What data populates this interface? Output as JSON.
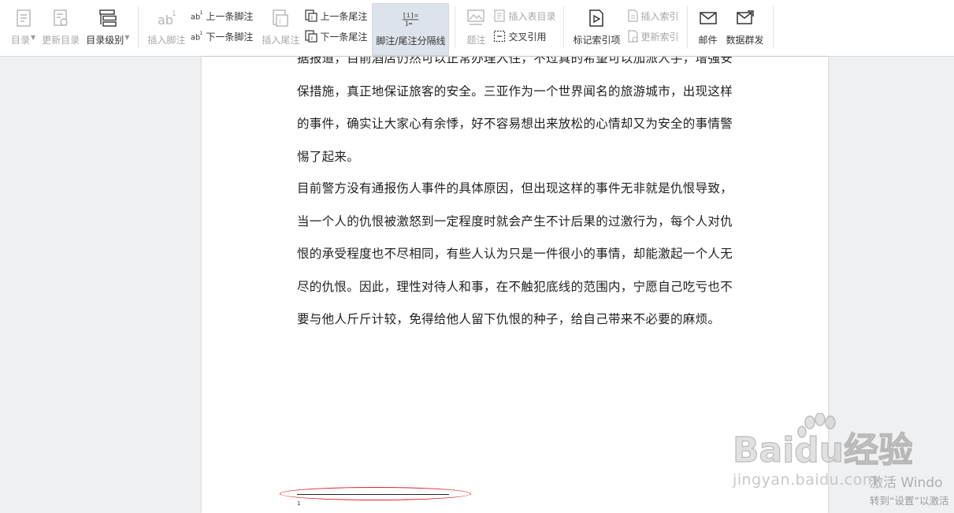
{
  "ribbon": {
    "toc": {
      "label": "目录"
    },
    "update_toc": {
      "label": "更新目录"
    },
    "toc_level": {
      "label": "目录级别"
    },
    "insert_footnote": {
      "label": "插入脚注"
    },
    "prev_footnote": {
      "label": "上一条脚注"
    },
    "next_footnote": {
      "label": "下一条脚注"
    },
    "insert_endnote": {
      "label": "插入尾注"
    },
    "prev_endnote": {
      "label": "上一条尾注"
    },
    "next_endnote": {
      "label": "下一条尾注"
    },
    "note_separator": {
      "label": "脚注/尾注分隔线"
    },
    "caption": {
      "label": "题注"
    },
    "insert_table_of_figures": {
      "label": "插入表目录"
    },
    "cross_reference": {
      "label": "交叉引用"
    },
    "mark_index_entry": {
      "label": "标记索引项"
    },
    "insert_index": {
      "label": "插入索引"
    },
    "update_index": {
      "label": "更新索引"
    },
    "mail": {
      "label": "邮件"
    },
    "mail_merge": {
      "label": "数据群发"
    }
  },
  "document": {
    "para1_lines": [
      "据报道，目前酒店仍然可以正常办理入住，不过真的希望可以加派人手，增强安",
      "保措施，真正地保证旅客的安全。三亚作为一个世界闻名的旅游城市，出现这样",
      "的事件，确实让大家心有余悸，好不容易想出来放松的心情却又为安全的事情警",
      "惕了起来。"
    ],
    "para2_lines": [
      "目前警方没有通报伤人事件的具体原因，但出现这样的事件无非就是仇恨导致，",
      "当一个人的仇恨被激怒到一定程度时就会产生不计后果的过激行为，每个人对仇",
      "恨的承受程度也不尽相同，有些人认为只是一件很小的事情，却能激起一个人无",
      "尽的仇恨。因此，理性对待人和事，在不触犯底线的范围内，宁愿自己吃亏也不",
      "要与他人斤斤计较，免得给他人留下仇恨的种子，给自己带来不必要的麻烦。"
    ],
    "footnote_number": "1"
  },
  "watermark": {
    "baidu_brand": "Baidu经验",
    "baidu_url": "jingyan.baidu.com",
    "activate_title": "激活 Windo",
    "activate_hint": "转到“设置”以激活"
  },
  "colors": {
    "annotation_ellipse": "#e0242a",
    "active_button_bg": "#dde3ea"
  }
}
